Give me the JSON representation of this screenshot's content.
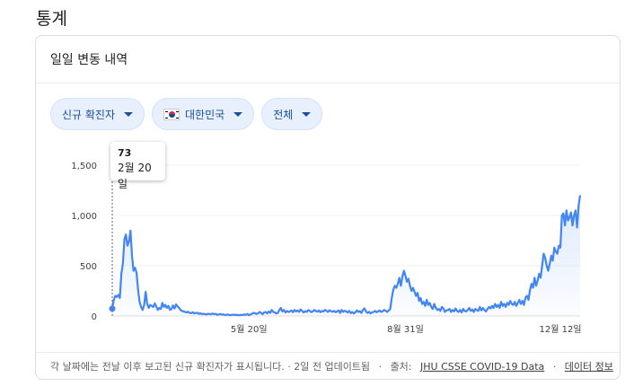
{
  "section_title": "통계",
  "card": {
    "title": "일일 변동 내역",
    "chips": {
      "metric": "신규 확진자",
      "country": "대한민국",
      "range": "전체"
    },
    "tooltip": {
      "value": "73",
      "date": "2월 20일"
    },
    "footer": {
      "note": "각 날짜에는 전날 이후 보고된 신규 확진자가 표시됩니다. · 2일 전 업데이트됨",
      "source_label": "출처:",
      "source_link": "JHU CSSE COVID-19 Data",
      "data_info_link": "데이터 정보"
    }
  },
  "colors": {
    "line": "#4285f4",
    "chip_bg": "#e8f0fe",
    "chip_text": "#1a4fa0",
    "grid": "#f1f3f4"
  },
  "chart_data": {
    "type": "line",
    "title": "",
    "xlabel": "",
    "ylabel": "",
    "ylim": [
      0,
      1500
    ],
    "yticks": [
      "0",
      "500",
      "1,000",
      "1,500"
    ],
    "ytick_values": [
      0,
      500,
      1000,
      1500
    ],
    "xticks": [
      "5월 20일",
      "8월 31일",
      "12월 12일"
    ],
    "xtick_positions": [
      90,
      193,
      295
    ],
    "x_unit": "day index since 2월 20일",
    "series": [
      {
        "values": [
          73,
          160,
          200,
          190,
          210,
          180,
          420,
          520,
          760,
          810,
          700,
          740,
          850,
          600,
          450,
          480,
          430,
          260,
          140,
          90,
          60,
          110,
          240,
          120,
          80,
          110,
          100,
          90,
          125,
          95,
          60,
          80,
          70,
          130,
          90,
          110,
          80,
          100,
          60,
          70,
          105,
          75,
          115,
          95,
          80,
          60,
          50,
          45,
          40,
          35,
          42,
          30,
          28,
          38,
          25,
          30,
          32,
          20,
          28,
          18,
          22,
          18,
          15,
          22,
          20,
          16,
          25,
          18,
          22,
          12,
          15,
          20,
          14,
          16,
          10,
          12,
          15,
          10,
          8,
          12,
          14,
          10,
          12,
          8,
          9,
          11,
          10,
          15,
          12,
          20,
          8,
          16,
          22,
          30,
          28,
          20,
          25,
          40,
          30,
          18,
          35,
          40,
          25,
          45,
          30,
          60,
          40,
          35,
          25,
          30,
          60,
          80,
          45,
          60,
          35,
          50,
          40,
          45,
          55,
          38,
          60,
          45,
          55,
          40,
          65,
          50,
          35,
          48,
          40,
          58,
          52,
          38,
          45,
          60,
          50,
          42,
          55,
          38,
          50,
          45,
          60,
          52,
          40,
          58,
          48,
          42,
          50,
          38,
          45,
          55,
          30,
          60,
          40,
          52,
          45,
          35,
          50,
          28,
          40,
          25,
          35,
          55,
          40,
          48,
          30,
          60,
          75,
          45,
          30,
          42,
          25,
          35,
          40,
          50,
          38,
          45,
          55,
          40,
          48,
          60,
          52,
          40,
          55,
          70,
          180,
          260,
          300,
          280,
          320,
          380,
          300,
          390,
          450,
          400,
          340,
          370,
          300,
          250,
          280,
          240,
          200,
          230,
          150,
          180,
          120,
          140,
          100,
          160,
          110,
          130,
          90,
          70,
          120,
          80,
          60,
          70,
          50,
          90,
          75,
          40,
          55,
          60,
          70,
          40,
          60,
          45,
          75,
          50,
          40,
          60,
          35,
          70,
          50,
          45,
          60,
          80,
          50,
          65,
          40,
          70,
          60,
          50,
          90,
          55,
          80,
          60,
          45,
          70,
          90,
          75,
          100,
          80,
          120,
          90,
          110,
          80,
          140,
          100,
          120,
          90,
          130,
          110,
          150,
          120,
          110,
          140,
          100,
          130,
          160,
          120,
          150,
          110,
          180,
          200,
          160,
          260,
          320,
          280,
          380,
          300,
          350,
          420,
          380,
          500,
          620,
          580,
          500,
          450,
          520,
          600,
          550,
          680,
          640,
          620,
          700,
          680,
          1000,
          1020,
          900,
          1050,
          950,
          980,
          1030,
          900,
          1000,
          1050,
          880,
          1100,
          1200
        ]
      }
    ]
  }
}
